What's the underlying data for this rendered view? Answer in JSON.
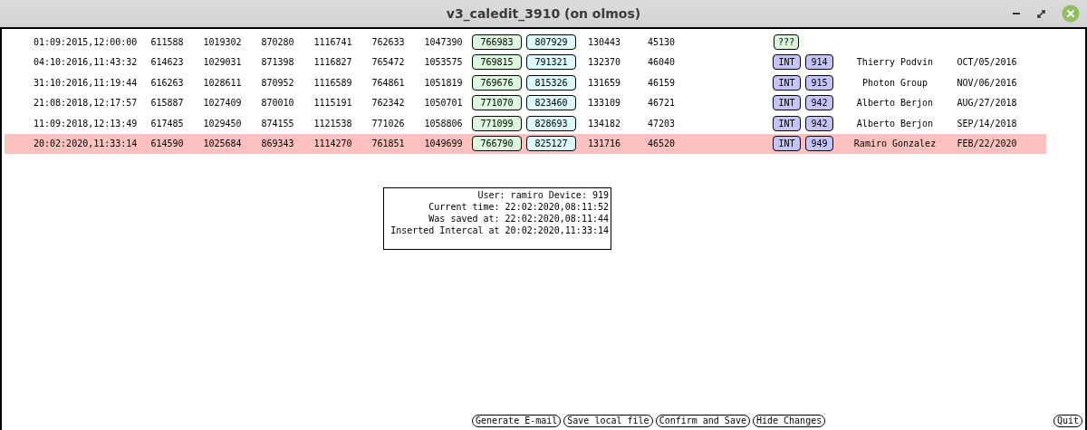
{
  "window": {
    "title": "v3_caledit_3910 (on olmos)"
  },
  "rows": [
    {
      "timestamp": "01:09:2015,12:00:00",
      "values": [
        "611588",
        "1019302",
        "870280",
        "1116741",
        "762633",
        "1047390"
      ],
      "green_value": "766983",
      "cyan_value": "807929",
      "value_10": "130443",
      "value_11": "45130",
      "tags": [
        {
          "text": "???",
          "kind": "unknown"
        }
      ],
      "selected": false
    },
    {
      "timestamp": "04:10:2016,11:43:32",
      "values": [
        "614623",
        "1029031",
        "871398",
        "1116827",
        "765472",
        "1053575"
      ],
      "green_value": "769815",
      "cyan_value": "791321",
      "value_10": "132370",
      "value_11": "46040",
      "tags": [
        {
          "text": "INT",
          "kind": "type"
        },
        {
          "text": "914",
          "kind": "device"
        }
      ],
      "name": "Thierry Podvin",
      "date": "OCT/05/2016",
      "selected": false
    },
    {
      "timestamp": "31:10:2016,11:19:44",
      "values": [
        "616263",
        "1028611",
        "870952",
        "1116589",
        "764861",
        "1051819"
      ],
      "green_value": "769676",
      "cyan_value": "815326",
      "value_10": "131659",
      "value_11": "46159",
      "tags": [
        {
          "text": "INT",
          "kind": "type"
        },
        {
          "text": "915",
          "kind": "device"
        }
      ],
      "name": "Photon Group",
      "date": "NOV/06/2016",
      "selected": false
    },
    {
      "timestamp": "21:08:2018,12:17:57",
      "values": [
        "615887",
        "1027409",
        "870010",
        "1115191",
        "762342",
        "1050701"
      ],
      "green_value": "771070",
      "cyan_value": "823460",
      "value_10": "133109",
      "value_11": "46721",
      "tags": [
        {
          "text": "INT",
          "kind": "type"
        },
        {
          "text": "942",
          "kind": "device"
        }
      ],
      "name": "Alberto Berjon",
      "date": "AUG/27/2018",
      "selected": false
    },
    {
      "timestamp": "11:09:2018,12:13:49",
      "values": [
        "617485",
        "1029450",
        "874155",
        "1121538",
        "771026",
        "1058806"
      ],
      "green_value": "771099",
      "cyan_value": "828693",
      "value_10": "134182",
      "value_11": "47203",
      "tags": [
        {
          "text": "INT",
          "kind": "type"
        },
        {
          "text": "942",
          "kind": "device"
        }
      ],
      "name": "Alberto Berjon",
      "date": "SEP/14/2018",
      "selected": false
    },
    {
      "timestamp": "20:02:2020,11:33:14",
      "values": [
        "614590",
        "1025684",
        "869343",
        "1114270",
        "761851",
        "1049699"
      ],
      "green_value": "766790",
      "cyan_value": "825127",
      "value_10": "131716",
      "value_11": "46520",
      "tags": [
        {
          "text": "INT",
          "kind": "type"
        },
        {
          "text": "949",
          "kind": "device"
        }
      ],
      "name": "Ramiro Gonzalez",
      "date": "FEB/22/2020",
      "selected": true
    }
  ],
  "info": {
    "lines": [
      "User: ramiro Device: 919",
      "Current time: 22:02:2020,08:11:52",
      "Was saved at: 22:02:2020,08:11:44",
      "Inserted Intercal at 20:02:2020,11:33:14"
    ]
  },
  "buttons": [
    "Generate E-mail",
    "Save local file",
    "Confirm and Save",
    "Hide Changes"
  ],
  "quit_button": "Quit"
}
